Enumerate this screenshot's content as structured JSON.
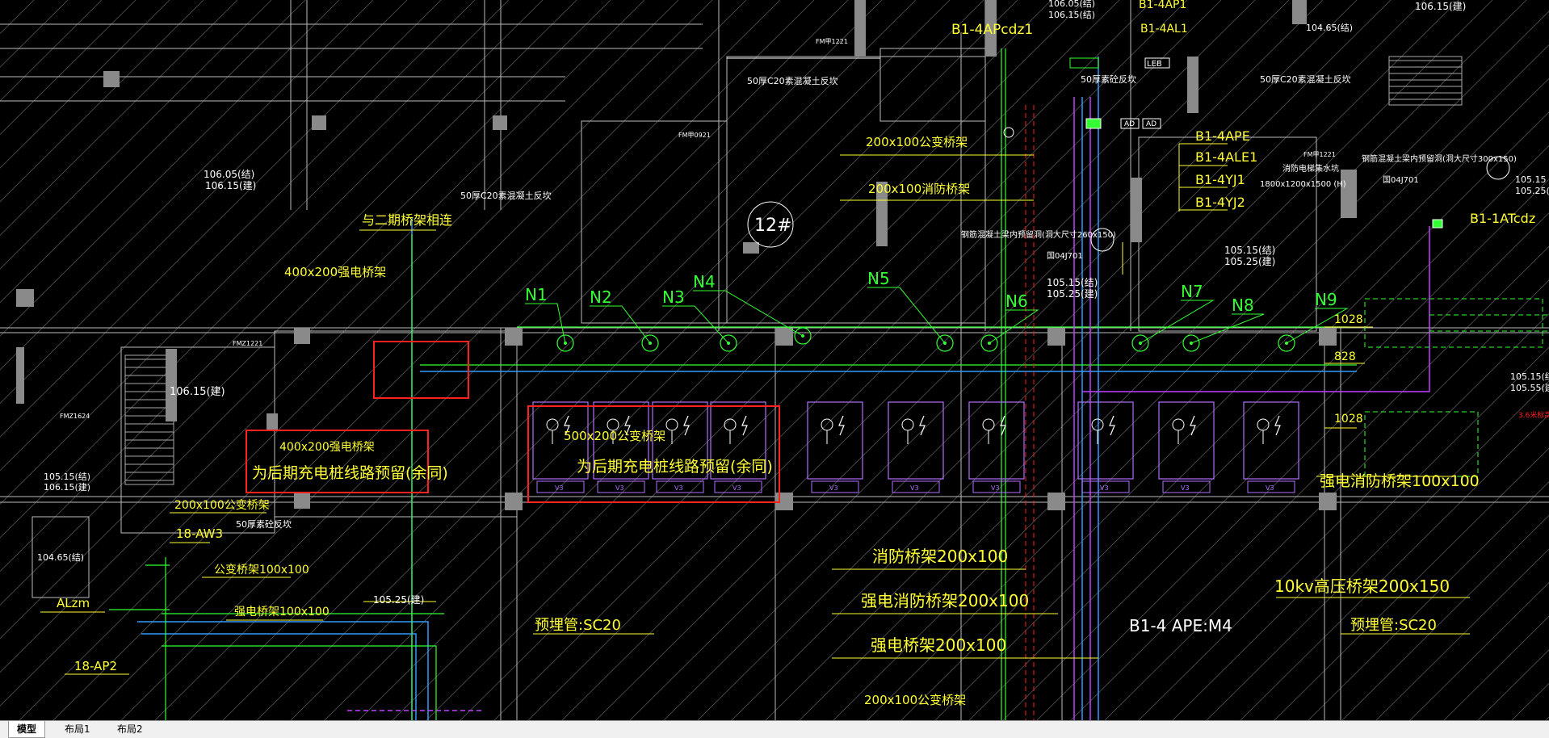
{
  "drawing": {
    "labels": {
      "b1_4apcdz1": "B1-4APcdz1",
      "b1_4ap1": "B1-4AP1",
      "b1_4al1": "B1-4AL1",
      "leb": "LEB",
      "b1_4ape": "B1-4APE",
      "b1_4ale1": "B1-4ALE1",
      "b1_4yj1": "B1-4YJ1",
      "b1_4yj2": "B1-4YJ2",
      "b1_1atcdz": "B1-1ATcdz",
      "concrete_top_1": "50厚C20素混凝土反坎",
      "concrete_top_2": "50厚C20素混凝土反坎",
      "concrete_mid": "50厚C20素混凝土反坎",
      "concrete_small": "50厚素砼反坎",
      "concrete_left": "50厚素砼反坎",
      "tray_200x100_common_top": "200x100公变桥架",
      "tray_200x100_fire_top": "200x100消防桥架",
      "connect_phase2": "与二期桥架相连",
      "tray_400x200_strong_top": "400x200强电桥架",
      "tray_400x200_strong_left": "400x200强电桥架",
      "reserve_left": "为后期充电桩线路预留(余同)",
      "tray_500x200_common": "500x200公变桥架",
      "reserve_mid": "为后期充电桩线路预留(余同)",
      "tray_200x100_common_left": "200x100公变桥架",
      "aw3": "18-AW3",
      "common_tray_100": "公变桥架100x100",
      "strong_tray_100": "强电桥架100x100",
      "alzm": "ALzm",
      "ap2": "18-AP2",
      "elev_105_25_mid": "105.25(建)",
      "prepipe_left": "预埋管:SC20",
      "prepipe_right": "预埋管:SC20",
      "fire_tray_200": "消防桥架200x100",
      "strong_fire_tray_200": "强电消防桥架200x100",
      "strong_tray_200": "强电桥架200x100",
      "common_tray_bottom": "200x100公变桥架",
      "ape_m4": "B1-4 APE:M4",
      "hv_tray": "10kv高压桥架200x150",
      "strong_fire_tray_right": "强电消防桥架100x100",
      "n1028_a": "1028",
      "n828": "828",
      "n1028_b": "1028",
      "elev_106_05": "106.05(结)",
      "elev_106_15": "106.15(建)",
      "elev_106_15_b": "106.15(建)",
      "elev_105_15_a": "105.15(结)",
      "elev_105_15_b": "106.15(建)",
      "elev_104_65": "104.65(结)",
      "elev_105_15_c": "105.15(结)",
      "elev_105_25_c": "105.25(建)",
      "elev_105_15_d": "105.15(结)",
      "elev_105_25_d": "105.25(建)",
      "elev_top_106_05": "106.05(结)",
      "elev_top_106_15": "106.15(结)",
      "elev_top_104_65": "104.65(结)",
      "elev_top_right": "106.15(建)",
      "elev_right_105_15": "105.15(结)",
      "elev_right_105_55": "105.55(建)",
      "elev_right_105_15b": "105.15",
      "elev_right_105_25b": "105.25(",
      "room_12": "12#",
      "cable_tray_note_1": "钢筋混凝土梁内预留洞(洞大尺寸260x150)",
      "cable_tray_note_2": "钢筋混凝土梁内预留洞(洞大尺寸300x150)",
      "atlas_1": "国04J701",
      "atlas_2": "国04J701",
      "fire_pump": "消防电梯集水坑",
      "pit_size": "1800x1200x1500 (H)",
      "fm1221_a": "FM甲1221",
      "fm1221_b": "FM甲1221",
      "fm0921": "FM甲0921",
      "fmz1221": "FMZ1221",
      "fmz1624": "FMZ1624",
      "red_note": "3.6米标高",
      "ad1": "AD",
      "ad2": "AD"
    },
    "nodes": [
      "N1",
      "N2",
      "N3",
      "N4",
      "N5",
      "N6",
      "N7",
      "N8",
      "N9"
    ],
    "stall_tag": "V3"
  },
  "tabs": [
    {
      "label": "模型",
      "active": true
    },
    {
      "label": "布局1",
      "active": false
    },
    {
      "label": "布局2",
      "active": false
    }
  ],
  "colors": {
    "annotation": "#ffff33",
    "highlight": "#ff2020",
    "cable": "#33ff33",
    "wall": "#888888",
    "stall": "#b070ff",
    "pipe": "#3399ff"
  }
}
